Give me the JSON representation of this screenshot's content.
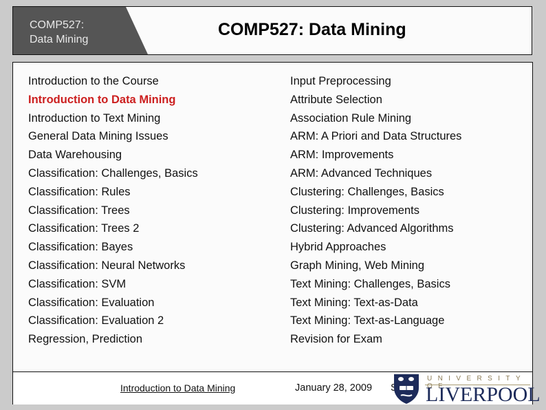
{
  "header": {
    "tab_line1": "COMP527:",
    "tab_line2": "Data Mining",
    "title": "COMP527: Data Mining"
  },
  "topics": {
    "left": [
      {
        "label": "Introduction to the Course",
        "active": false
      },
      {
        "label": "Introduction to Data Mining",
        "active": true
      },
      {
        "label": "Introduction to Text Mining",
        "active": false
      },
      {
        "label": "General Data Mining Issues",
        "active": false
      },
      {
        "label": "Data Warehousing",
        "active": false
      },
      {
        "label": "Classification: Challenges, Basics",
        "active": false
      },
      {
        "label": "Classification: Rules",
        "active": false
      },
      {
        "label": "Classification: Trees",
        "active": false
      },
      {
        "label": "Classification: Trees 2",
        "active": false
      },
      {
        "label": "Classification: Bayes",
        "active": false
      },
      {
        "label": "Classification: Neural Networks",
        "active": false
      },
      {
        "label": "Classification: SVM",
        "active": false
      },
      {
        "label": "Classification: Evaluation",
        "active": false
      },
      {
        "label": "Classification: Evaluation 2",
        "active": false
      },
      {
        "label": "Regression, Prediction",
        "active": false
      }
    ],
    "right": [
      {
        "label": "Input Preprocessing",
        "active": false
      },
      {
        "label": "Attribute Selection",
        "active": false
      },
      {
        "label": "Association Rule Mining",
        "active": false
      },
      {
        "label": "ARM: A Priori and Data Structures",
        "active": false
      },
      {
        "label": "ARM: Improvements",
        "active": false
      },
      {
        "label": "ARM: Advanced Techniques",
        "active": false
      },
      {
        "label": "Clustering: Challenges, Basics",
        "active": false
      },
      {
        "label": "Clustering: Improvements",
        "active": false
      },
      {
        "label": "Clustering: Advanced Algorithms",
        "active": false
      },
      {
        "label": "Hybrid Approaches",
        "active": false
      },
      {
        "label": "Graph Mining, Web Mining",
        "active": false
      },
      {
        "label": "Text Mining: Challenges, Basics",
        "active": false
      },
      {
        "label": "Text Mining: Text-as-Data",
        "active": false
      },
      {
        "label": "Text Mining: Text-as-Language",
        "active": false
      },
      {
        "label": "Revision for Exam",
        "active": false
      }
    ]
  },
  "footer": {
    "link_text": "Introduction to Data Mining",
    "date": "January 28, 2009",
    "slide_prefix": "S",
    "logo_top": "UNIVERSITY OF",
    "logo_name": "LIVERPOOL"
  },
  "colors": {
    "active_topic": "#cc1f1f",
    "header_tab": "#555555",
    "logo_navy": "#1d2b5a",
    "logo_gold": "#8a7a55"
  }
}
